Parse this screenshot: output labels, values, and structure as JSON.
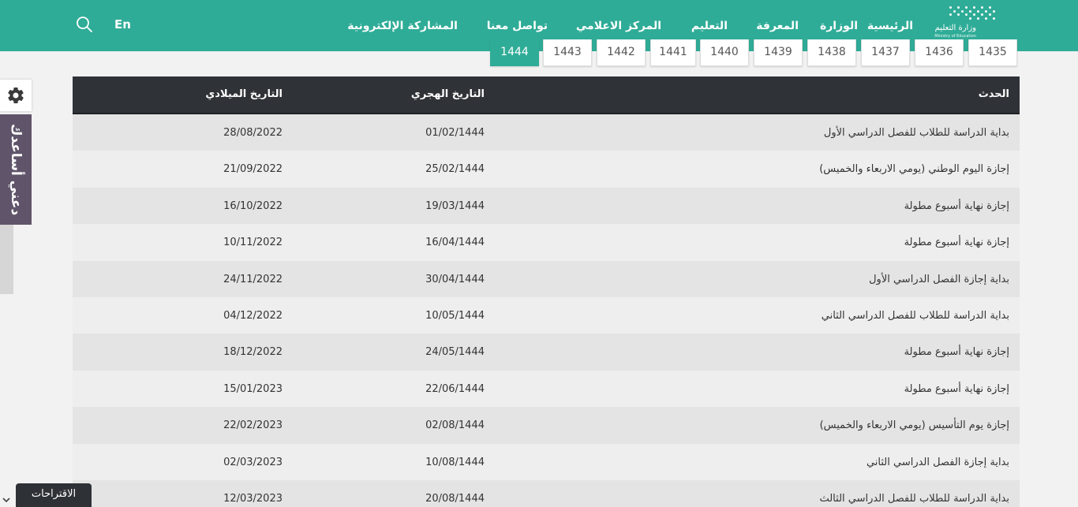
{
  "header": {
    "logo_arabic": "وزارة التعليم",
    "logo_english": "Ministry of Education",
    "nav": [
      {
        "label": "الرئيسية",
        "dropdown": false
      },
      {
        "label": "الوزارة",
        "dropdown": true
      },
      {
        "label": "المعرفة",
        "dropdown": true
      },
      {
        "label": "التعليم",
        "dropdown": true
      },
      {
        "label": "المركز الاعلامي",
        "dropdown": true
      },
      {
        "label": "تواصل معنا",
        "dropdown": true
      },
      {
        "label": "المشاركة الإلكترونية",
        "dropdown": true
      }
    ],
    "language_label": "En",
    "search_icon": "search-icon"
  },
  "year_tabs": {
    "items": [
      "1435",
      "1436",
      "1437",
      "1438",
      "1439",
      "1440",
      "1441",
      "1442",
      "1443",
      "1444"
    ],
    "selected": "1444"
  },
  "table": {
    "headers": {
      "event": "الحدث",
      "hijri": "التاريخ الهجري",
      "gregorian": "التاريخ الميلادي"
    },
    "rows": [
      {
        "event": "بداية الدراسة للطلاب للفصل الدراسي الأول",
        "hijri": "01/02/1444",
        "gregorian": "28/08/2022"
      },
      {
        "event": "إجازة اليوم الوطني (يومي الاربعاء والخميس)",
        "hijri": "25/02/1444",
        "gregorian": "21/09/2022"
      },
      {
        "event": "إجازة نهاية أسبوع مطولة",
        "hijri": "19/03/1444",
        "gregorian": "16/10/2022"
      },
      {
        "event": "إجازة نهاية أسبوع مطولة",
        "hijri": "16/04/1444",
        "gregorian": "10/11/2022"
      },
      {
        "event": "بداية إجازة الفصل الدراسي الأول",
        "hijri": "30/04/1444",
        "gregorian": "24/11/2022"
      },
      {
        "event": "بداية الدراسة للطلاب للفصل الدراسي الثاني",
        "hijri": "10/05/1444",
        "gregorian": "04/12/2022"
      },
      {
        "event": "إجازة نهاية أسبوع مطولة",
        "hijri": "24/05/1444",
        "gregorian": "18/12/2022"
      },
      {
        "event": "إجازة نهاية أسبوع مطولة",
        "hijri": "22/06/1444",
        "gregorian": "15/01/2023"
      },
      {
        "event": "إجازة يوم التأسيس (يومي الاربعاء والخميس)",
        "hijri": "02/08/1444",
        "gregorian": "22/02/2023"
      },
      {
        "event": "بداية إجازة الفصل الدراسي الثاني",
        "hijri": "10/08/1444",
        "gregorian": "02/03/2023"
      },
      {
        "event": "بداية الدراسة للطلاب للفصل الدراسي الثالث",
        "hijri": "20/08/1444",
        "gregorian": "12/03/2023"
      }
    ]
  },
  "help_widget": {
    "settings_icon": "gear-icon",
    "label": "دعني أساعدك"
  },
  "suggestions_button": "الاقتراحات",
  "colors": {
    "brand": "#2fac97",
    "table_header": "#2f3237",
    "help_tab": "#5f5469"
  }
}
